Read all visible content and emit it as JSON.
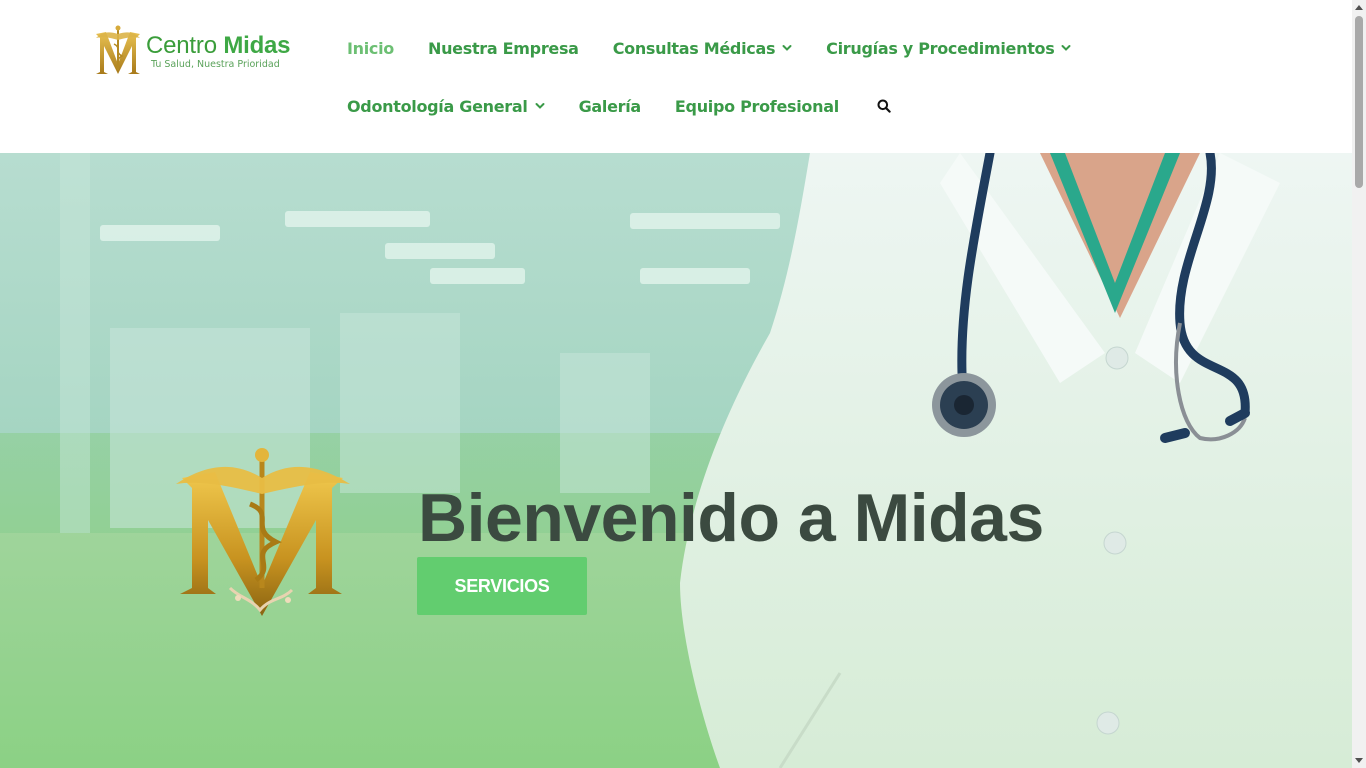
{
  "header": {
    "brand": {
      "name_regular": "Centro ",
      "name_bold": "Midas",
      "tagline": "Tu Salud, Nuestra Prioridad"
    },
    "nav": {
      "items": [
        {
          "label": "Inicio",
          "active": true,
          "has_dropdown": false
        },
        {
          "label": "Nuestra Empresa",
          "active": false,
          "has_dropdown": false
        },
        {
          "label": "Consultas Médicas",
          "active": false,
          "has_dropdown": true
        },
        {
          "label": "Cirugías y Procedimientos",
          "active": false,
          "has_dropdown": true
        },
        {
          "label": "Odontología General",
          "active": false,
          "has_dropdown": true
        },
        {
          "label": "Galería",
          "active": false,
          "has_dropdown": false
        },
        {
          "label": "Equipo Profesional",
          "active": false,
          "has_dropdown": false
        }
      ],
      "search_icon": "search-icon"
    }
  },
  "hero": {
    "title": "Bienvenido a Midas",
    "cta_label": "SERVICIOS"
  },
  "colors": {
    "brand_green": "#3a9a48",
    "active_link": "#6cbf73",
    "cta_green": "#62cd6f",
    "hero_title": "#3b4a40",
    "gold": "#c9a02c"
  }
}
